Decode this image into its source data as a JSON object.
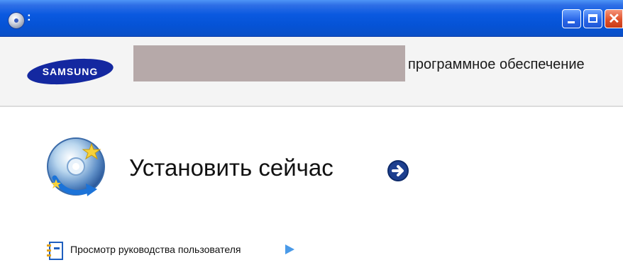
{
  "window": {
    "title_text": ":",
    "controls": [
      "minimize",
      "maximize",
      "close"
    ]
  },
  "header": {
    "logo_text": "SAMSUNG",
    "text": "программное обеспечение"
  },
  "install": {
    "label": "Установить сейчас",
    "icon": "install-disc-icon",
    "action_icon": "arrow-right-circle-icon"
  },
  "manual_link": {
    "label": "Просмотр руководства пользователя",
    "icon": "notebook-icon",
    "arrow_icon": "play-arrow-icon"
  },
  "colors": {
    "titlebar_blue": "#0553d6",
    "samsung_blue": "#1428a0",
    "redacted_bar": "#b6a9a9",
    "header_bg": "#f4f4f4"
  }
}
